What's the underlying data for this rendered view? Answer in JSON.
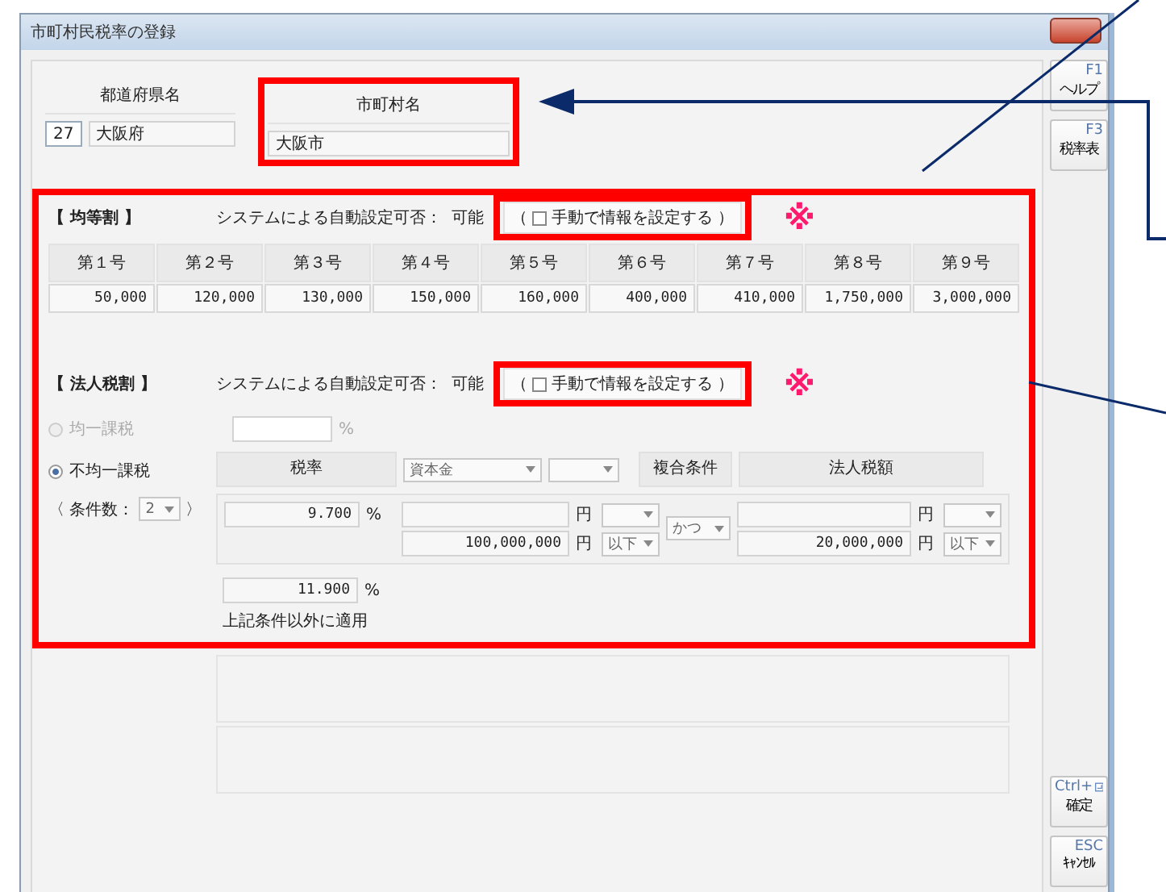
{
  "window": {
    "title": "市町村民税率の登録"
  },
  "header": {
    "prefecture": {
      "label": "都道府県名",
      "code": "27",
      "name": "大阪府"
    },
    "municipality": {
      "label": "市町村名",
      "name": "大阪市"
    }
  },
  "per_capita": {
    "title": "【 均等割 】",
    "auto_label": "システムによる自動設定可否：",
    "auto_value": "可能",
    "manual": {
      "open": "（",
      "label": "手動で情報を設定する",
      "close": "）",
      "checked": false
    },
    "columns": [
      {
        "label": "第１号",
        "value": "50,000"
      },
      {
        "label": "第２号",
        "value": "120,000"
      },
      {
        "label": "第３号",
        "value": "130,000"
      },
      {
        "label": "第４号",
        "value": "150,000"
      },
      {
        "label": "第５号",
        "value": "160,000"
      },
      {
        "label": "第６号",
        "value": "400,000"
      },
      {
        "label": "第７号",
        "value": "410,000"
      },
      {
        "label": "第８号",
        "value": "1,750,000"
      },
      {
        "label": "第９号",
        "value": "3,000,000"
      }
    ]
  },
  "corporate": {
    "title": "【 法人税割 】",
    "auto_label": "システムによる自動設定可否：",
    "auto_value": "可能",
    "manual": {
      "open": "（",
      "label": "手動で情報を設定する",
      "close": "）",
      "checked": false
    },
    "options": [
      {
        "label": "均一課税",
        "selected": false,
        "disabled": true
      },
      {
        "label": "不均一課税",
        "selected": true,
        "disabled": false
      }
    ],
    "uniform_unit": "%",
    "condition_count": {
      "open": "〈 条件数：",
      "value": "2",
      "close": "〉"
    },
    "headers": {
      "rate": "税率",
      "basis": "資本金",
      "compound": "複合条件",
      "tax": "法人税額"
    },
    "condition": {
      "rate": "9.700",
      "rate_unit": "%",
      "basis_lower_unit": "円",
      "basis_upper": "100,000,000",
      "basis_upper_unit": "円",
      "basis_upper_op": "以下",
      "compound": "かつ",
      "tax_lower_unit": "円",
      "tax_upper": "20,000,000",
      "tax_upper_unit": "円",
      "tax_upper_op": "以下"
    },
    "default": {
      "rate": "11.900",
      "rate_unit": "%",
      "note": "上記条件以外に適用"
    }
  },
  "side_buttons": [
    {
      "key": "F1",
      "label": "ヘルプ",
      "kind": "top"
    },
    {
      "key": "F3",
      "label": "税率表",
      "kind": "top"
    },
    {
      "key": "Ctrl+",
      "label": "確定",
      "kind": "bottom",
      "icon": true
    },
    {
      "key": "ESC",
      "label": "ｷｬﾝｾﾙ",
      "kind": "bottom"
    }
  ],
  "annotations": {
    "marks": [
      "※",
      "※"
    ]
  }
}
